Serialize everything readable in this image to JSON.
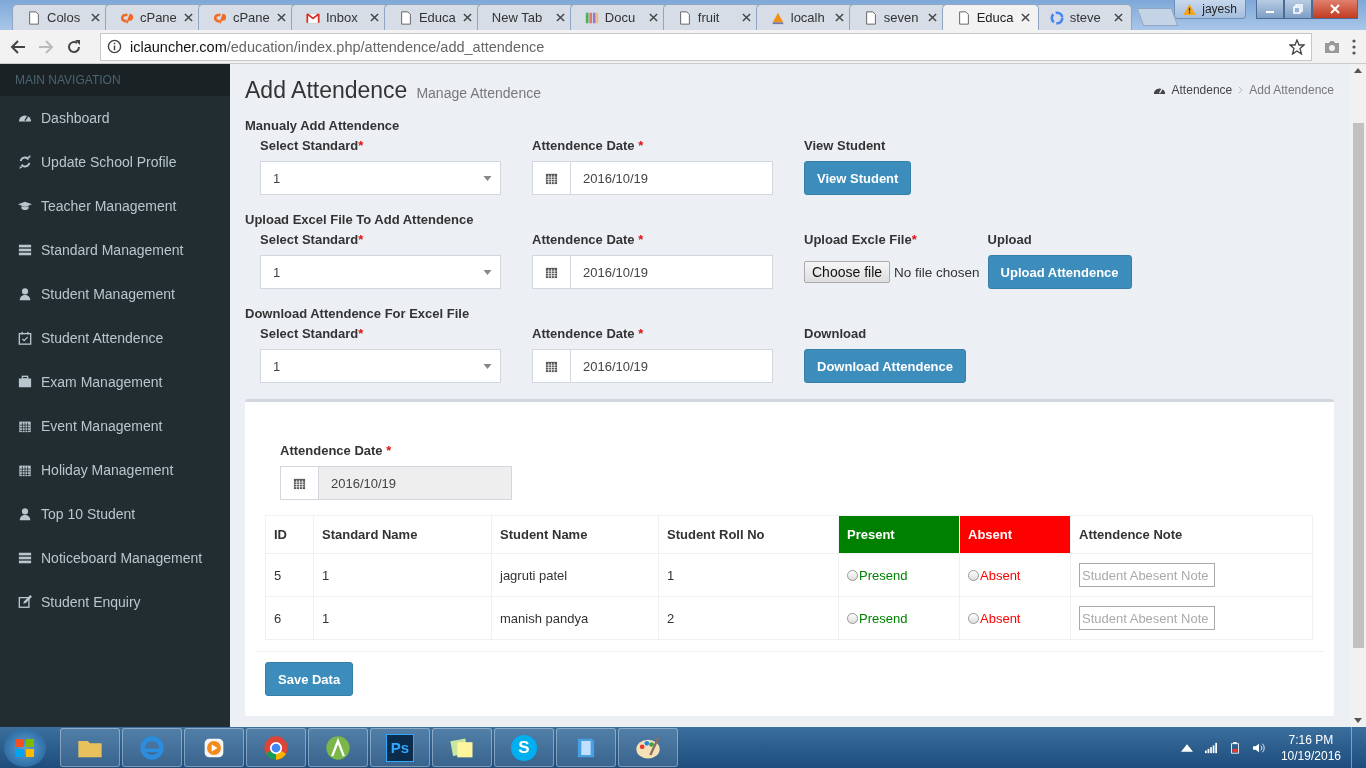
{
  "browser": {
    "tabs": [
      {
        "title": "Colos",
        "kind": "page",
        "selected": false
      },
      {
        "title": "cPane",
        "kind": "cpanel",
        "selected": false
      },
      {
        "title": "cPane",
        "kind": "cpanel",
        "selected": false
      },
      {
        "title": "Inbox",
        "kind": "mail",
        "selected": false
      },
      {
        "title": "Educa",
        "kind": "page",
        "selected": false
      },
      {
        "title": "New Tab",
        "kind": "blank",
        "selected": false
      },
      {
        "title": "Docu",
        "kind": "docs",
        "selected": false
      },
      {
        "title": "fruit",
        "kind": "page",
        "selected": false
      },
      {
        "title": "localh",
        "kind": "pma",
        "selected": false
      },
      {
        "title": "seven",
        "kind": "page",
        "selected": false
      },
      {
        "title": "Educa",
        "kind": "page",
        "selected": true
      },
      {
        "title": "steve",
        "kind": "google",
        "selected": false
      }
    ],
    "user": "jayesh",
    "address": {
      "host": "iclauncher.com",
      "path": "/education/index.php/attendence/add_attendence"
    }
  },
  "sidebar": {
    "header": "MAIN NAVIGATION",
    "items": [
      {
        "label": "Dashboard",
        "kind": "dashboard",
        "selected": false
      },
      {
        "label": "Update School Profile",
        "kind": "refresh",
        "selected": false
      },
      {
        "label": "Teacher Management",
        "kind": "cap",
        "selected": false
      },
      {
        "label": "Standard Management",
        "kind": "list",
        "selected": false
      },
      {
        "label": "Student Management",
        "kind": "user",
        "selected": false
      },
      {
        "label": "Student Attendence",
        "kind": "calcheck",
        "selected": false
      },
      {
        "label": "Exam Management",
        "kind": "briefcase",
        "selected": false
      },
      {
        "label": "Event Management",
        "kind": "calendar",
        "selected": false
      },
      {
        "label": "Holiday Management",
        "kind": "calendar",
        "selected": false
      },
      {
        "label": "Top 10 Student",
        "kind": "user",
        "selected": false
      },
      {
        "label": "Noticeboard Management",
        "kind": "list",
        "selected": false
      },
      {
        "label": "Student Enquiry",
        "kind": "edit",
        "selected": false
      }
    ]
  },
  "page": {
    "title": "Add Attendence",
    "subtitle": "Manage Attendence",
    "breadcrumb": [
      "Attendence",
      "Add Attendence"
    ]
  },
  "sections": [
    {
      "heading": "Manualy Add Attendence",
      "standard": {
        "label": "Select Standard",
        "required_mark": "*",
        "value": "1"
      },
      "date": {
        "label": "Attendence Date",
        "required_mark": "*",
        "value": "2016/10/19"
      },
      "actions": [
        {
          "kind": "button",
          "label": "View Student",
          "button": "View Student"
        }
      ]
    },
    {
      "heading": "Upload Excel File To Add Attendence",
      "standard": {
        "label": "Select Standard",
        "required_mark": "*",
        "value": "1"
      },
      "date": {
        "label": "Attendence Date",
        "required_mark": "*",
        "value": "2016/10/19"
      },
      "actions": [
        {
          "kind": "file",
          "label": "Upload Excle File",
          "required_mark": "*",
          "button": "Choose file",
          "status": "No file chosen"
        },
        {
          "kind": "button",
          "label": "Upload",
          "button": "Upload Attendence"
        }
      ]
    },
    {
      "heading": "Download Attendence For Excel File",
      "standard": {
        "label": "Select Standard",
        "required_mark": "*",
        "value": "1"
      },
      "date": {
        "label": "Attendence Date",
        "required_mark": "*",
        "value": "2016/10/19"
      },
      "actions": [
        {
          "kind": "button",
          "label": "Download",
          "button": "Download Attendence"
        }
      ]
    }
  ],
  "panel": {
    "date": {
      "label": "Attendence Date",
      "required_mark": "*",
      "value": "2016/10/19",
      "disabled": true
    },
    "table": {
      "columns": [
        {
          "label": "ID"
        },
        {
          "label": "Standard Name"
        },
        {
          "label": "Student Name"
        },
        {
          "label": "Student Roll No"
        },
        {
          "label": "Present",
          "color": "#008000"
        },
        {
          "label": "Absent",
          "color": "#ff0000"
        },
        {
          "label": "Attendence Note"
        }
      ],
      "rows": [
        {
          "cells": [
            "5",
            "1",
            "jagruti patel",
            "1"
          ],
          "present": {
            "label": "Presend",
            "checked": false
          },
          "absent": {
            "label": "Absent",
            "checked": false
          },
          "note": {
            "placeholder": "Student Abesent Note"
          }
        },
        {
          "cells": [
            "6",
            "1",
            "manish pandya",
            "2"
          ],
          "present": {
            "label": "Presend",
            "checked": false
          },
          "absent": {
            "label": "Absent",
            "checked": false
          },
          "note": {
            "placeholder": "Student Abesent Note"
          }
        }
      ]
    },
    "save_button": "Save Data"
  },
  "taskbar": {
    "apps": [
      {
        "kind": "folder"
      },
      {
        "kind": "ie"
      },
      {
        "kind": "media"
      },
      {
        "kind": "chrome"
      },
      {
        "kind": "android"
      },
      {
        "kind": "ps",
        "label": "Ps"
      },
      {
        "kind": "notes"
      },
      {
        "kind": "skype",
        "label": "S"
      },
      {
        "kind": "book"
      },
      {
        "kind": "paint"
      }
    ],
    "clock": {
      "time": "7:16 PM",
      "date": "10/19/2016"
    }
  }
}
